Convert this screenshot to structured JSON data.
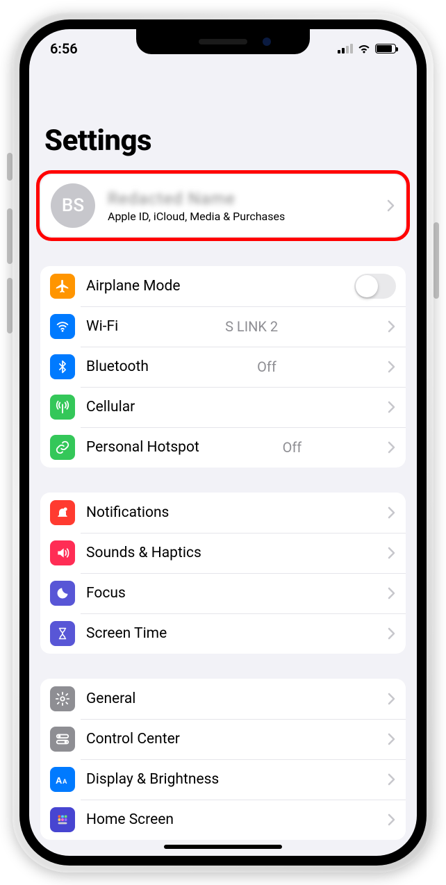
{
  "status": {
    "time": "6:56"
  },
  "page_title": "Settings",
  "profile": {
    "initials": "BS",
    "name": "Redacted Name",
    "subtitle": "Apple ID, iCloud, Media & Purchases"
  },
  "groups": [
    {
      "rows": [
        {
          "icon": "airplane",
          "icon_bg": "#ff9500",
          "label": "Airplane Mode",
          "trailing": "toggle-off"
        },
        {
          "icon": "wifi",
          "icon_bg": "#007aff",
          "label": "Wi-Fi",
          "detail": "S LINK 2",
          "trailing": "chevron"
        },
        {
          "icon": "bluetooth",
          "icon_bg": "#007aff",
          "label": "Bluetooth",
          "detail": "Off",
          "trailing": "chevron"
        },
        {
          "icon": "antenna",
          "icon_bg": "#34c759",
          "label": "Cellular",
          "trailing": "chevron"
        },
        {
          "icon": "link",
          "icon_bg": "#34c759",
          "label": "Personal Hotspot",
          "detail": "Off",
          "trailing": "chevron"
        }
      ]
    },
    {
      "rows": [
        {
          "icon": "bell",
          "icon_bg": "#ff3b30",
          "label": "Notifications",
          "trailing": "chevron"
        },
        {
          "icon": "speaker",
          "icon_bg": "#ff2d55",
          "label": "Sounds & Haptics",
          "trailing": "chevron"
        },
        {
          "icon": "moon",
          "icon_bg": "#5856d6",
          "label": "Focus",
          "trailing": "chevron"
        },
        {
          "icon": "hourglass",
          "icon_bg": "#5856d6",
          "label": "Screen Time",
          "trailing": "chevron"
        }
      ]
    },
    {
      "rows": [
        {
          "icon": "gear",
          "icon_bg": "#8e8e93",
          "label": "General",
          "trailing": "chevron"
        },
        {
          "icon": "switches",
          "icon_bg": "#8e8e93",
          "label": "Control Center",
          "trailing": "chevron"
        },
        {
          "icon": "textsize",
          "icon_bg": "#007aff",
          "label": "Display & Brightness",
          "trailing": "chevron"
        },
        {
          "icon": "grid",
          "icon_bg": "#4745d1",
          "label": "Home Screen",
          "trailing": "chevron"
        }
      ]
    }
  ]
}
